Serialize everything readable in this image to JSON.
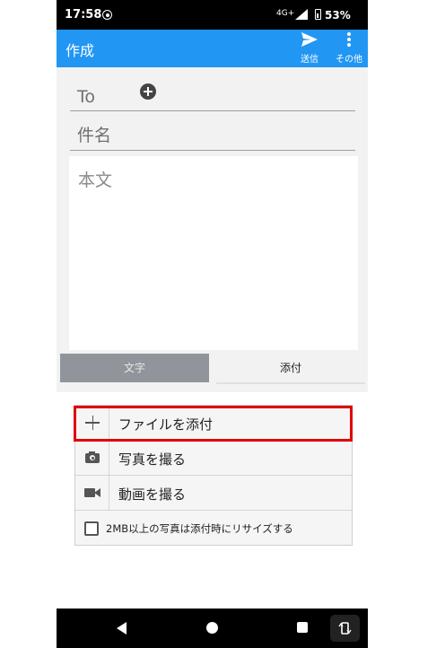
{
  "status_bar": {
    "time": "17:58",
    "network": "4G+",
    "battery": "53%"
  },
  "app_bar": {
    "title": "作成",
    "send_label": "送信",
    "more_label": "その他"
  },
  "compose": {
    "to_placeholder": "To",
    "subject_placeholder": "件名",
    "body_placeholder": "本文"
  },
  "tabs": {
    "text_tab": "文字",
    "attach_tab": "添付"
  },
  "attach_options": {
    "attach_file": "ファイルを添付",
    "take_photo": "写真を撮る",
    "take_video": "動画を撮る",
    "resize_checkbox_label": "2MB以上の写真は添付時にリサイズする",
    "resize_checked": false
  },
  "colors": {
    "app_bar": "#2196f3",
    "highlight": "#e00000",
    "status_bar": "#000000"
  }
}
